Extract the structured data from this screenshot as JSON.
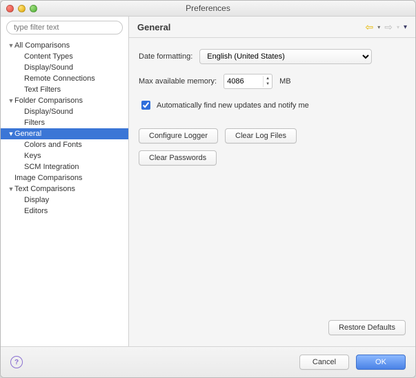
{
  "window": {
    "title": "Preferences"
  },
  "sidebar": {
    "filter_placeholder": "type filter text",
    "items": [
      {
        "label": "All Comparisons",
        "level": 0,
        "expanded": true,
        "children": true
      },
      {
        "label": "Content Types",
        "level": 1
      },
      {
        "label": "Display/Sound",
        "level": 1
      },
      {
        "label": "Remote Connections",
        "level": 1
      },
      {
        "label": "Text Filters",
        "level": 1
      },
      {
        "label": "Folder Comparisons",
        "level": 0,
        "expanded": true,
        "children": true
      },
      {
        "label": "Display/Sound",
        "level": 1
      },
      {
        "label": "Filters",
        "level": 1
      },
      {
        "label": "General",
        "level": 0,
        "expanded": true,
        "children": true,
        "selected": true
      },
      {
        "label": "Colors and Fonts",
        "level": 1
      },
      {
        "label": "Keys",
        "level": 1
      },
      {
        "label": "SCM Integration",
        "level": 1
      },
      {
        "label": "Image Comparisons",
        "level": 0,
        "children": false
      },
      {
        "label": "Text Comparisons",
        "level": 0,
        "expanded": true,
        "children": true
      },
      {
        "label": "Display",
        "level": 1
      },
      {
        "label": "Editors",
        "level": 1
      }
    ]
  },
  "header": {
    "title": "General"
  },
  "form": {
    "date_label": "Date formatting:",
    "date_value": "English (United States)",
    "mem_label": "Max available memory:",
    "mem_value": "4086",
    "mem_unit": "MB",
    "auto_update_label": "Automatically find new updates and notify me",
    "auto_update_checked": true,
    "configure_logger": "Configure Logger",
    "clear_log": "Clear Log Files",
    "clear_passwords": "Clear Passwords",
    "restore_defaults": "Restore Defaults"
  },
  "footer": {
    "cancel": "Cancel",
    "ok": "OK"
  }
}
